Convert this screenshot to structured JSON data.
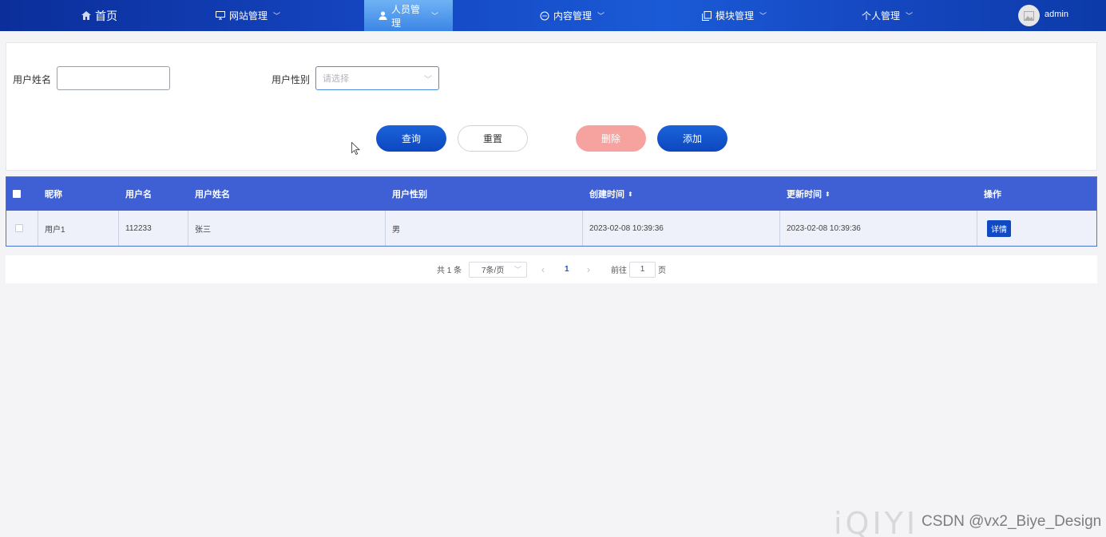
{
  "nav": {
    "items": [
      {
        "label": "首页",
        "icon": "home-icon"
      },
      {
        "label": "网站管理",
        "icon": "monitor-icon"
      },
      {
        "label": "人员管理",
        "icon": "user-icon"
      },
      {
        "label": "内容管理",
        "icon": "chat-icon"
      },
      {
        "label": "模块管理",
        "icon": "copy-icon"
      },
      {
        "label": "个人管理",
        "icon": ""
      }
    ],
    "user": "admin"
  },
  "search": {
    "name_label": "用户姓名",
    "name_value": "",
    "gender_label": "用户性别",
    "gender_placeholder": "请选择",
    "buttons": {
      "query": "查询",
      "reset": "重置",
      "delete": "删除",
      "add": "添加"
    }
  },
  "table": {
    "headers": [
      "昵称",
      "用户名",
      "用户姓名",
      "用户性别",
      "创建时间",
      "更新时间",
      "操作"
    ],
    "rows": [
      {
        "nickname": "用户1",
        "username": "112233",
        "realname": "张三",
        "gender": "男",
        "created": "2023-02-08 10:39:36",
        "updated": "2023-02-08 10:39:36",
        "action": "详情"
      }
    ]
  },
  "pager": {
    "total": "共 1 条",
    "page_size": "7条/页",
    "current": "1",
    "goto_prefix": "前往",
    "goto_value": "1",
    "goto_suffix": "页"
  },
  "watermark": {
    "logo": "iQIYI",
    "text": "CSDN @vx2_Biye_Design"
  },
  "colors": {
    "nav": "#1546c2",
    "header": "#3f5fd4",
    "primary": "#1149c2",
    "danger": "#f6a39f"
  }
}
